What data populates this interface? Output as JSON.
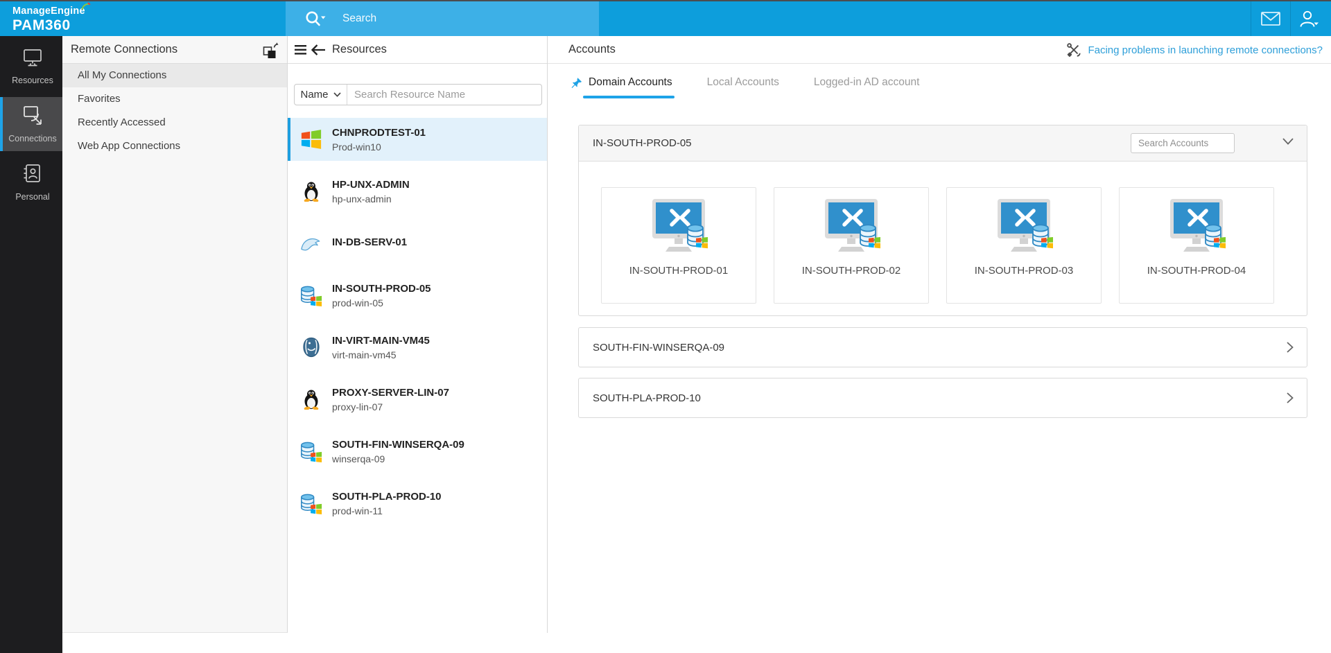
{
  "topbar": {
    "brand_line1": "ManageEngine",
    "brand_line2": "PAM360",
    "search_placeholder": "Search"
  },
  "sidebar": {
    "items": [
      {
        "label": "Resources",
        "icon": "monitor-icon",
        "active": false
      },
      {
        "label": "Connections",
        "icon": "remote-connection-icon",
        "active": true
      },
      {
        "label": "Personal",
        "icon": "address-book-icon",
        "active": false
      }
    ]
  },
  "connections_panel": {
    "title": "Remote Connections",
    "items": [
      {
        "label": "All My Connections",
        "selected": true
      },
      {
        "label": "Favorites",
        "selected": false
      },
      {
        "label": "Recently Accessed",
        "selected": false
      },
      {
        "label": "Web App Connections",
        "selected": false
      }
    ]
  },
  "resources_panel": {
    "title": "Resources",
    "filter_label": "Name",
    "search_placeholder": "Search Resource Name",
    "items": [
      {
        "name": "CHNPRODTEST-01",
        "subtitle": "Prod-win10",
        "icon": "windows-icon",
        "selected": true
      },
      {
        "name": "HP-UNX-ADMIN",
        "subtitle": "hp-unx-admin",
        "icon": "linux-icon",
        "selected": false
      },
      {
        "name": "IN-DB-SERV-01",
        "subtitle": "",
        "icon": "mysql-icon",
        "selected": false
      },
      {
        "name": "IN-SOUTH-PROD-05",
        "subtitle": "prod-win-05",
        "icon": "windows-database-icon",
        "selected": false
      },
      {
        "name": "IN-VIRT-MAIN-VM45",
        "subtitle": "virt-main-vm45",
        "icon": "postgresql-icon",
        "selected": false
      },
      {
        "name": "PROXY-SERVER-LIN-07",
        "subtitle": "proxy-lin-07",
        "icon": "linux-icon",
        "selected": false
      },
      {
        "name": "SOUTH-FIN-WINSERQA-09",
        "subtitle": "winserqa-09",
        "icon": "windows-database-icon",
        "selected": false
      },
      {
        "name": "SOUTH-PLA-PROD-10",
        "subtitle": "prod-win-11",
        "icon": "windows-database-icon",
        "selected": false
      }
    ]
  },
  "accounts_panel": {
    "title": "Accounts",
    "help_link": "Facing problems in launching remote connections?",
    "tabs": [
      {
        "label": "Domain Accounts",
        "active": true
      },
      {
        "label": "Local Accounts",
        "active": false
      },
      {
        "label": "Logged-in AD account",
        "active": false
      }
    ],
    "group_search_placeholder": "Search Accounts",
    "groups": [
      {
        "name": "IN-SOUTH-PROD-05",
        "expanded": true
      },
      {
        "name": "SOUTH-FIN-WINSERQA-09",
        "expanded": false
      },
      {
        "name": "SOUTH-PLA-PROD-10",
        "expanded": false
      }
    ],
    "accounts": [
      {
        "name": "IN-SOUTH-PROD-01"
      },
      {
        "name": "IN-SOUTH-PROD-02"
      },
      {
        "name": "IN-SOUTH-PROD-03"
      },
      {
        "name": "IN-SOUTH-PROD-04"
      }
    ]
  },
  "colors": {
    "topbar": "#0d9edc",
    "topbar_search": "#3db0e7",
    "accent": "#1ea3e8",
    "link": "#2e9fd9",
    "sidebar_bg": "#1d1d1f",
    "sidebar_active": "#49494b",
    "panel_bg": "#f7f7f7",
    "selected_row": "#e2f1fb"
  }
}
